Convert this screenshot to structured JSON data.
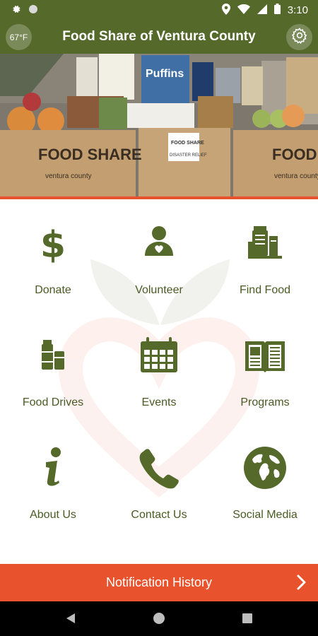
{
  "status_bar": {
    "time": "3:10",
    "icons": [
      "settings-small-icon",
      "circle-icon",
      "location-icon",
      "wifi-icon",
      "signal-icon",
      "battery-icon"
    ]
  },
  "app_bar": {
    "title": "Food Share of Ventura County",
    "weather": "67°F",
    "settings_icon": "gear-icon"
  },
  "hero": {
    "box_texts": [
      "FOOD SHARE",
      "ventura county",
      "FOOD SHARE",
      "DISASTER RELIEF",
      "FOOD SHARE",
      "ventura county"
    ],
    "product_text": "Puffins"
  },
  "menu": {
    "tiles": [
      {
        "label": "Donate",
        "icon": "dollar-icon"
      },
      {
        "label": "Volunteer",
        "icon": "volunteer-icon"
      },
      {
        "label": "Find Food",
        "icon": "pantry-icon"
      },
      {
        "label": "Food Drives",
        "icon": "food-cans-icon"
      },
      {
        "label": "Events",
        "icon": "calendar-icon"
      },
      {
        "label": "Programs",
        "icon": "open-book-icon"
      },
      {
        "label": "About Us",
        "icon": "info-icon"
      },
      {
        "label": "Contact Us",
        "icon": "phone-icon"
      },
      {
        "label": "Social Media",
        "icon": "globe-icon"
      }
    ],
    "icon_color": "#55692b",
    "label_color": "#4a5a23"
  },
  "notification_bar": {
    "label": "Notification History",
    "color": "#e8522d"
  },
  "nav_bar": {
    "buttons": [
      "back-icon",
      "home-icon",
      "recents-icon"
    ]
  },
  "colors": {
    "brand_green": "#55692b",
    "accent_orange": "#e8522d"
  }
}
